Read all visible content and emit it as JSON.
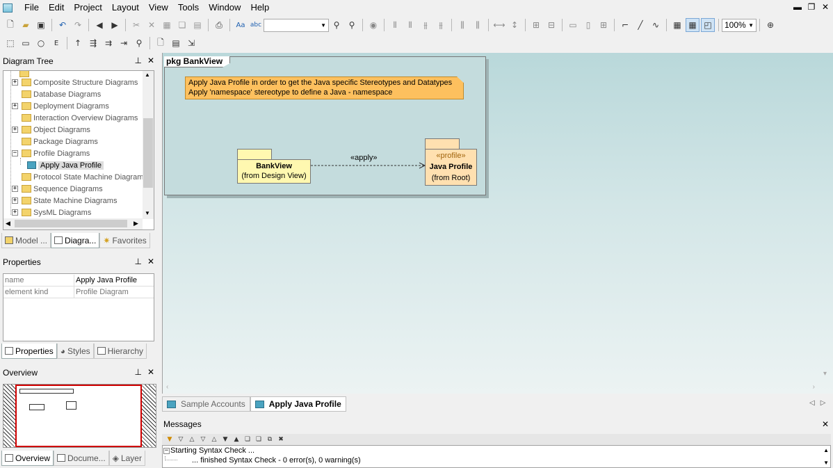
{
  "menu": {
    "items": [
      "File",
      "Edit",
      "Project",
      "Layout",
      "View",
      "Tools",
      "Window",
      "Help"
    ]
  },
  "toolbar": {
    "zoom_value": "100%",
    "row1_icons": [
      "new-icon",
      "open-icon",
      "save-icon",
      "undo-icon",
      "redo-icon",
      "back-icon",
      "forward-icon",
      "cut-icon",
      "delete-icon",
      "copy-image-icon",
      "copy-icon",
      "paste-icon",
      "print-icon",
      "find-text-icon",
      "spell-icon"
    ],
    "row2_icons": [
      "select-icon",
      "rectangle-icon",
      "ellipse-icon",
      "text-icon",
      "anchor-icon",
      "path-icon",
      "route-icon",
      "hyperlink-icon",
      "zoom-tool-icon",
      "note-icon",
      "document-icon",
      "swap-icon"
    ]
  },
  "diagram_tree": {
    "title": "Diagram Tree",
    "items": [
      {
        "label": "Composite Structure Diagrams",
        "expander": "+",
        "kind": "folder"
      },
      {
        "label": "Database Diagrams",
        "expander": "",
        "kind": "folder"
      },
      {
        "label": "Deployment Diagrams",
        "expander": "+",
        "kind": "folder"
      },
      {
        "label": "Interaction Overview Diagrams",
        "expander": "",
        "kind": "folder"
      },
      {
        "label": "Object Diagrams",
        "expander": "+",
        "kind": "folder"
      },
      {
        "label": "Package Diagrams",
        "expander": "",
        "kind": "folder"
      },
      {
        "label": "Profile Diagrams",
        "expander": "-",
        "kind": "folder"
      },
      {
        "label": "Apply Java Profile",
        "expander": "",
        "kind": "diagram",
        "selected": true
      },
      {
        "label": "Protocol State Machine Diagrams",
        "expander": "",
        "kind": "folder"
      },
      {
        "label": "Sequence Diagrams",
        "expander": "+",
        "kind": "folder"
      },
      {
        "label": "State Machine Diagrams",
        "expander": "+",
        "kind": "folder"
      },
      {
        "label": "SysML Diagrams",
        "expander": "+",
        "kind": "folder"
      }
    ],
    "tabs": [
      "Model ...",
      "Diagra...",
      "Favorites"
    ]
  },
  "properties": {
    "title": "Properties",
    "rows": [
      {
        "name": "name",
        "value": "Apply Java Profile"
      },
      {
        "name": "element kind",
        "value": "Profile Diagram"
      }
    ],
    "tabs": [
      "Properties",
      "Styles",
      "Hierarchy"
    ]
  },
  "overview": {
    "title": "Overview",
    "tabs": [
      "Overview",
      "Docume...",
      "Layer"
    ]
  },
  "diagram": {
    "frame_label": "pkg BankView",
    "note_lines": [
      "Apply Java Profile in order to get the Java specific Stereotypes and Datatypes",
      "Apply 'namespace' stereotype to define a Java - namespace"
    ],
    "bankview": {
      "name": "BankView",
      "from": "(from Design View)"
    },
    "java_profile": {
      "stereotype": "«profile»",
      "name": "Java Profile",
      "from": "(from Root)"
    },
    "dependency_label": "«apply»"
  },
  "doc_tabs": [
    {
      "label": "Sample Accounts",
      "active": false
    },
    {
      "label": "Apply Java Profile",
      "active": true
    }
  ],
  "messages": {
    "title": "Messages",
    "lines": [
      "Starting Syntax Check ...",
      "... finished Syntax Check - 0 error(s), 0 warning(s)"
    ]
  },
  "colors": {
    "note": "#fdc05e",
    "package": "#fff8b0",
    "profile": "#ffe0b0",
    "selection_border": "#d10000"
  }
}
